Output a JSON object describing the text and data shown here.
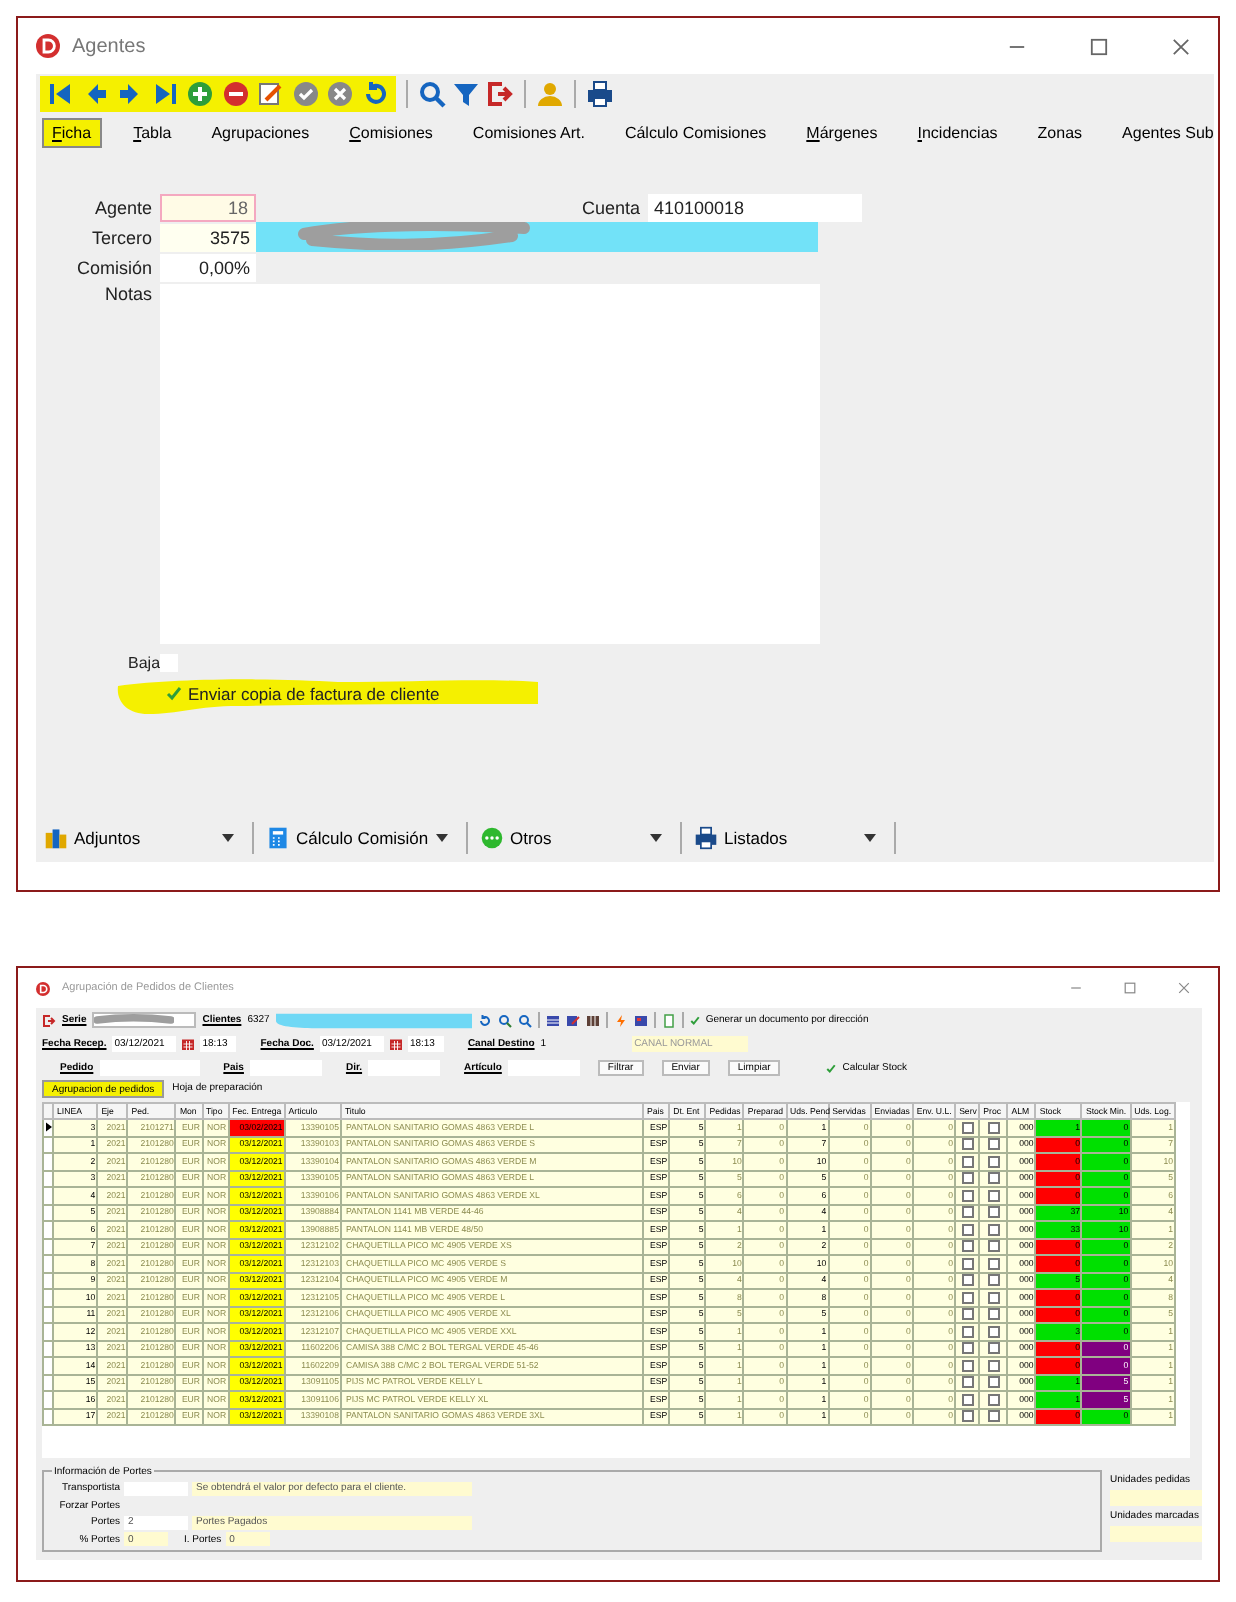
{
  "agentes_window": {
    "title": "Agentes",
    "tabs": [
      {
        "label": "Ficha",
        "mnemonic": true,
        "selected": true
      },
      {
        "label": "Tabla",
        "mnemonic": true,
        "selected": false
      },
      {
        "label": "Agrupaciones",
        "mnemonic": false,
        "selected": false
      },
      {
        "label": "Comisiones",
        "mnemonic": true,
        "selected": false
      },
      {
        "label": "Comisiones Art.",
        "mnemonic": false,
        "selected": false
      },
      {
        "label": "Cálculo Comisiones",
        "mnemonic": false,
        "selected": false
      },
      {
        "label": "Márgenes",
        "mnemonic": true,
        "selected": false
      },
      {
        "label": "Incidencias",
        "mnemonic": true,
        "selected": false
      },
      {
        "label": "Zonas",
        "mnemonic": false,
        "selected": false
      },
      {
        "label": "Agentes Sub",
        "mnemonic": false,
        "selected": false
      }
    ],
    "form": {
      "agente": {
        "label": "Agente",
        "value": "18"
      },
      "cuenta": {
        "label": "Cuenta",
        "value": "410100018"
      },
      "tercero": {
        "label": "Tercero",
        "value": "3575"
      },
      "comision": {
        "label": "Comisión",
        "value": "0,00%"
      },
      "notas": {
        "label": "Notas"
      },
      "baja": {
        "label": "Baja",
        "checked": false
      },
      "enviar_copia": {
        "label": "Enviar copia de factura de cliente",
        "checked": true
      }
    },
    "bottom_toolbar": [
      {
        "kind": "attach",
        "label": "Adjuntos"
      },
      {
        "kind": "calculator",
        "label": "Cálculo Comisión"
      },
      {
        "kind": "more",
        "label": "Otros"
      },
      {
        "kind": "print",
        "label": "Listados"
      }
    ]
  },
  "agrupacion_window": {
    "title": "Agrupación de Pedidos de Clientes",
    "serie_label": "Serie",
    "clientes_label": "Clientes",
    "clientes_value": "6327",
    "generar": {
      "label": "Generar un documento por dirección",
      "checked": true
    },
    "fecha_recep": {
      "label": "Fecha Recep.",
      "date": "03/12/2021",
      "time": "18:13"
    },
    "fecha_doc": {
      "label": "Fecha Doc.",
      "date": "03/12/2021",
      "time": "18:13"
    },
    "canal": {
      "label": "Canal Destino",
      "value": "1",
      "name": "CANAL NORMAL"
    },
    "filters": [
      {
        "label": "Pedido"
      },
      {
        "label": "Pais"
      },
      {
        "label": "Dir."
      },
      {
        "label": "Artículo"
      }
    ],
    "buttons": [
      "Filtrar",
      "Enviar",
      "Limpiar"
    ],
    "calcular_stock": {
      "label": "Calcular Stock",
      "checked": true
    },
    "tabs": [
      {
        "label": "Agrupacion de pedidos",
        "selected": true
      },
      {
        "label": "Hoja de preparación",
        "selected": false
      }
    ],
    "table": {
      "columns": [
        "LINEA",
        "Eje",
        "Ped.",
        "Mon",
        "Tipo",
        "Fec. Entrega",
        "Articulo",
        "Titulo",
        "Pais",
        "Dt. Ent",
        "Pedidas",
        "Preparad",
        "Uds. Pend",
        "Servidas",
        "Enviadas",
        "Env. U.L.",
        "Serv",
        "Proc",
        "ALM",
        "Stock",
        "Stock Min.",
        "Uds. Log."
      ],
      "rows": [
        {
          "selected": true,
          "cells": [
            "3",
            "2021",
            "2101271",
            "EUR",
            "NOR",
            {
              "text": "03/02/2021",
              "color": "#ff0000"
            },
            "13390105",
            "PANTALON SANITARIO GOMAS 4863 VERDE L",
            "ESP",
            "5",
            "1",
            "0",
            "1",
            "0",
            "0",
            "0",
            {
              "checked": false
            },
            {
              "checked": false
            },
            "000",
            {
              "text": "1",
              "color": "#00e000"
            },
            {
              "text": "0",
              "color": "#00e000"
            },
            "1"
          ]
        },
        {
          "selected": false,
          "cells": [
            "1",
            "2021",
            "2101280",
            "EUR",
            "NOR",
            {
              "text": "03/12/2021",
              "color": "#ffff00"
            },
            "13390103",
            "PANTALON SANITARIO GOMAS 4863 VERDE S",
            "ESP",
            "5",
            "7",
            "0",
            "7",
            "0",
            "0",
            "0",
            {
              "checked": false
            },
            {
              "checked": false
            },
            "000",
            {
              "text": "0",
              "color": "#ff0000"
            },
            {
              "text": "0",
              "color": "#00e000"
            },
            "7"
          ]
        },
        {
          "selected": false,
          "cells": [
            "2",
            "2021",
            "2101280",
            "EUR",
            "NOR",
            {
              "text": "03/12/2021",
              "color": "#ffff00"
            },
            "13390104",
            "PANTALON SANITARIO GOMAS 4863 VERDE M",
            "ESP",
            "5",
            "10",
            "0",
            "10",
            "0",
            "0",
            "0",
            {
              "checked": false
            },
            {
              "checked": false
            },
            "000",
            {
              "text": "0",
              "color": "#ff0000"
            },
            {
              "text": "0",
              "color": "#00e000"
            },
            "10"
          ]
        },
        {
          "selected": false,
          "cells": [
            "3",
            "2021",
            "2101280",
            "EUR",
            "NOR",
            {
              "text": "03/12/2021",
              "color": "#ffff00"
            },
            "13390105",
            "PANTALON SANITARIO GOMAS 4863 VERDE L",
            "ESP",
            "5",
            "5",
            "0",
            "5",
            "0",
            "0",
            "0",
            {
              "checked": false
            },
            {
              "checked": false
            },
            "000",
            {
              "text": "0",
              "color": "#ff0000"
            },
            {
              "text": "0",
              "color": "#00e000"
            },
            "5"
          ]
        },
        {
          "selected": false,
          "cells": [
            "4",
            "2021",
            "2101280",
            "EUR",
            "NOR",
            {
              "text": "03/12/2021",
              "color": "#ffff00"
            },
            "13390106",
            "PANTALON SANITARIO GOMAS 4863 VERDE XL",
            "ESP",
            "5",
            "6",
            "0",
            "6",
            "0",
            "0",
            "0",
            {
              "checked": false
            },
            {
              "checked": false
            },
            "000",
            {
              "text": "0",
              "color": "#ff0000"
            },
            {
              "text": "0",
              "color": "#00e000"
            },
            "6"
          ]
        },
        {
          "selected": false,
          "cells": [
            "5",
            "2021",
            "2101280",
            "EUR",
            "NOR",
            {
              "text": "03/12/2021",
              "color": "#ffff00"
            },
            "13908884",
            "PANTALON 1141 MB VERDE 44-46",
            "ESP",
            "5",
            "4",
            "0",
            "4",
            "0",
            "0",
            "0",
            {
              "checked": false
            },
            {
              "checked": false
            },
            "000",
            {
              "text": "37",
              "color": "#00e000"
            },
            {
              "text": "10",
              "color": "#00e000"
            },
            "4"
          ]
        },
        {
          "selected": false,
          "cells": [
            "6",
            "2021",
            "2101280",
            "EUR",
            "NOR",
            {
              "text": "03/12/2021",
              "color": "#ffff00"
            },
            "13908885",
            "PANTALON 1141 MB VERDE 48/50",
            "ESP",
            "5",
            "1",
            "0",
            "1",
            "0",
            "0",
            "0",
            {
              "checked": false
            },
            {
              "checked": false
            },
            "000",
            {
              "text": "33",
              "color": "#00e000"
            },
            {
              "text": "10",
              "color": "#00e000"
            },
            "1"
          ]
        },
        {
          "selected": false,
          "cells": [
            "7",
            "2021",
            "2101280",
            "EUR",
            "NOR",
            {
              "text": "03/12/2021",
              "color": "#ffff00"
            },
            "12312102",
            "CHAQUETILLA PICO MC 4905 VERDE XS",
            "ESP",
            "5",
            "2",
            "0",
            "2",
            "0",
            "0",
            "0",
            {
              "checked": false
            },
            {
              "checked": false
            },
            "000",
            {
              "text": "0",
              "color": "#ff0000"
            },
            {
              "text": "0",
              "color": "#00e000"
            },
            "2"
          ]
        },
        {
          "selected": false,
          "cells": [
            "8",
            "2021",
            "2101280",
            "EUR",
            "NOR",
            {
              "text": "03/12/2021",
              "color": "#ffff00"
            },
            "12312103",
            "CHAQUETILLA PICO MC 4905 VERDE S",
            "ESP",
            "5",
            "10",
            "0",
            "10",
            "0",
            "0",
            "0",
            {
              "checked": false
            },
            {
              "checked": false
            },
            "000",
            {
              "text": "0",
              "color": "#ff0000"
            },
            {
              "text": "0",
              "color": "#00e000"
            },
            "10"
          ]
        },
        {
          "selected": false,
          "cells": [
            "9",
            "2021",
            "2101280",
            "EUR",
            "NOR",
            {
              "text": "03/12/2021",
              "color": "#ffff00"
            },
            "12312104",
            "CHAQUETILLA PICO MC 4905 VERDE M",
            "ESP",
            "5",
            "4",
            "0",
            "4",
            "0",
            "0",
            "0",
            {
              "checked": false
            },
            {
              "checked": false
            },
            "000",
            {
              "text": "5",
              "color": "#00e000"
            },
            {
              "text": "0",
              "color": "#00e000"
            },
            "4"
          ]
        },
        {
          "selected": false,
          "cells": [
            "10",
            "2021",
            "2101280",
            "EUR",
            "NOR",
            {
              "text": "03/12/2021",
              "color": "#ffff00"
            },
            "12312105",
            "CHAQUETILLA PICO MC 4905 VERDE L",
            "ESP",
            "5",
            "8",
            "0",
            "8",
            "0",
            "0",
            "0",
            {
              "checked": false
            },
            {
              "checked": false
            },
            "000",
            {
              "text": "0",
              "color": "#ff0000"
            },
            {
              "text": "0",
              "color": "#00e000"
            },
            "8"
          ]
        },
        {
          "selected": false,
          "cells": [
            "11",
            "2021",
            "2101280",
            "EUR",
            "NOR",
            {
              "text": "03/12/2021",
              "color": "#ffff00"
            },
            "12312106",
            "CHAQUETILLA PICO MC 4905 VERDE XL",
            "ESP",
            "5",
            "5",
            "0",
            "5",
            "0",
            "0",
            "0",
            {
              "checked": false
            },
            {
              "checked": false
            },
            "000",
            {
              "text": "0",
              "color": "#ff0000"
            },
            {
              "text": "0",
              "color": "#00e000"
            },
            "5"
          ]
        },
        {
          "selected": false,
          "cells": [
            "12",
            "2021",
            "2101280",
            "EUR",
            "NOR",
            {
              "text": "03/12/2021",
              "color": "#ffff00"
            },
            "12312107",
            "CHAQUETILLA PICO MC 4905 VERDE XXL",
            "ESP",
            "5",
            "1",
            "0",
            "1",
            "0",
            "0",
            "0",
            {
              "checked": false
            },
            {
              "checked": false
            },
            "000",
            {
              "text": "3",
              "color": "#00e000"
            },
            {
              "text": "0",
              "color": "#00e000"
            },
            "1"
          ]
        },
        {
          "selected": false,
          "cells": [
            "13",
            "2021",
            "2101280",
            "EUR",
            "NOR",
            {
              "text": "03/12/2021",
              "color": "#ffff00"
            },
            "11602206",
            "CAMISA 388 C/MC 2 BOL TERGAL VERDE 45-46",
            "ESP",
            "5",
            "1",
            "0",
            "1",
            "0",
            "0",
            "0",
            {
              "checked": false
            },
            {
              "checked": false
            },
            "000",
            {
              "text": "0",
              "color": "#ff0000"
            },
            {
              "text": "0",
              "color": "#800080"
            },
            "1"
          ]
        },
        {
          "selected": false,
          "cells": [
            "14",
            "2021",
            "2101280",
            "EUR",
            "NOR",
            {
              "text": "03/12/2021",
              "color": "#ffff00"
            },
            "11602209",
            "CAMISA 388 C/MC 2 BOL TERGAL VERDE 51-52",
            "ESP",
            "5",
            "1",
            "0",
            "1",
            "0",
            "0",
            "0",
            {
              "checked": false
            },
            {
              "checked": false
            },
            "000",
            {
              "text": "0",
              "color": "#ff0000"
            },
            {
              "text": "0",
              "color": "#800080"
            },
            "1"
          ]
        },
        {
          "selected": false,
          "cells": [
            "15",
            "2021",
            "2101280",
            "EUR",
            "NOR",
            {
              "text": "03/12/2021",
              "color": "#ffff00"
            },
            "13091105",
            "PIJS MC PATROL VERDE KELLY L",
            "ESP",
            "5",
            "1",
            "0",
            "1",
            "0",
            "0",
            "0",
            {
              "checked": false
            },
            {
              "checked": false
            },
            "000",
            {
              "text": "1",
              "color": "#00e000"
            },
            {
              "text": "5",
              "color": "#800080"
            },
            "1"
          ]
        },
        {
          "selected": false,
          "cells": [
            "16",
            "2021",
            "2101280",
            "EUR",
            "NOR",
            {
              "text": "03/12/2021",
              "color": "#ffff00"
            },
            "13091106",
            "PIJS MC PATROL VERDE KELLY XL",
            "ESP",
            "5",
            "1",
            "0",
            "1",
            "0",
            "0",
            "0",
            {
              "checked": false
            },
            {
              "checked": false
            },
            "000",
            {
              "text": "1",
              "color": "#00e000"
            },
            {
              "text": "5",
              "color": "#800080"
            },
            "1"
          ]
        },
        {
          "selected": false,
          "cells": [
            "17",
            "2021",
            "2101280",
            "EUR",
            "NOR",
            {
              "text": "03/12/2021",
              "color": "#ffff00"
            },
            "13390108",
            "PANTALON SANITARIO GOMAS 4863 VERDE 3XL",
            "ESP",
            "5",
            "1",
            "0",
            "1",
            "0",
            "0",
            "0",
            {
              "checked": false
            },
            {
              "checked": false
            },
            "000",
            {
              "text": "0",
              "color": "#ff0000"
            },
            {
              "text": "0",
              "color": "#00e000"
            },
            "1"
          ]
        }
      ]
    },
    "portes": {
      "title": "Información de Portes",
      "transportista": {
        "label": "Transportista",
        "hint": "Se obtendrá el valor por defecto para el cliente."
      },
      "forzar": {
        "label": "Forzar Portes"
      },
      "portes": {
        "label": "Portes",
        "value": "2",
        "name": "Portes Pagados"
      },
      "pct": {
        "label": "% Portes",
        "value": "0"
      },
      "importe": {
        "label": "I. Portes",
        "value": "0"
      }
    },
    "unidades": [
      {
        "label": "Unidades pedidas"
      },
      {
        "label": "Unidades marcadas"
      }
    ]
  }
}
